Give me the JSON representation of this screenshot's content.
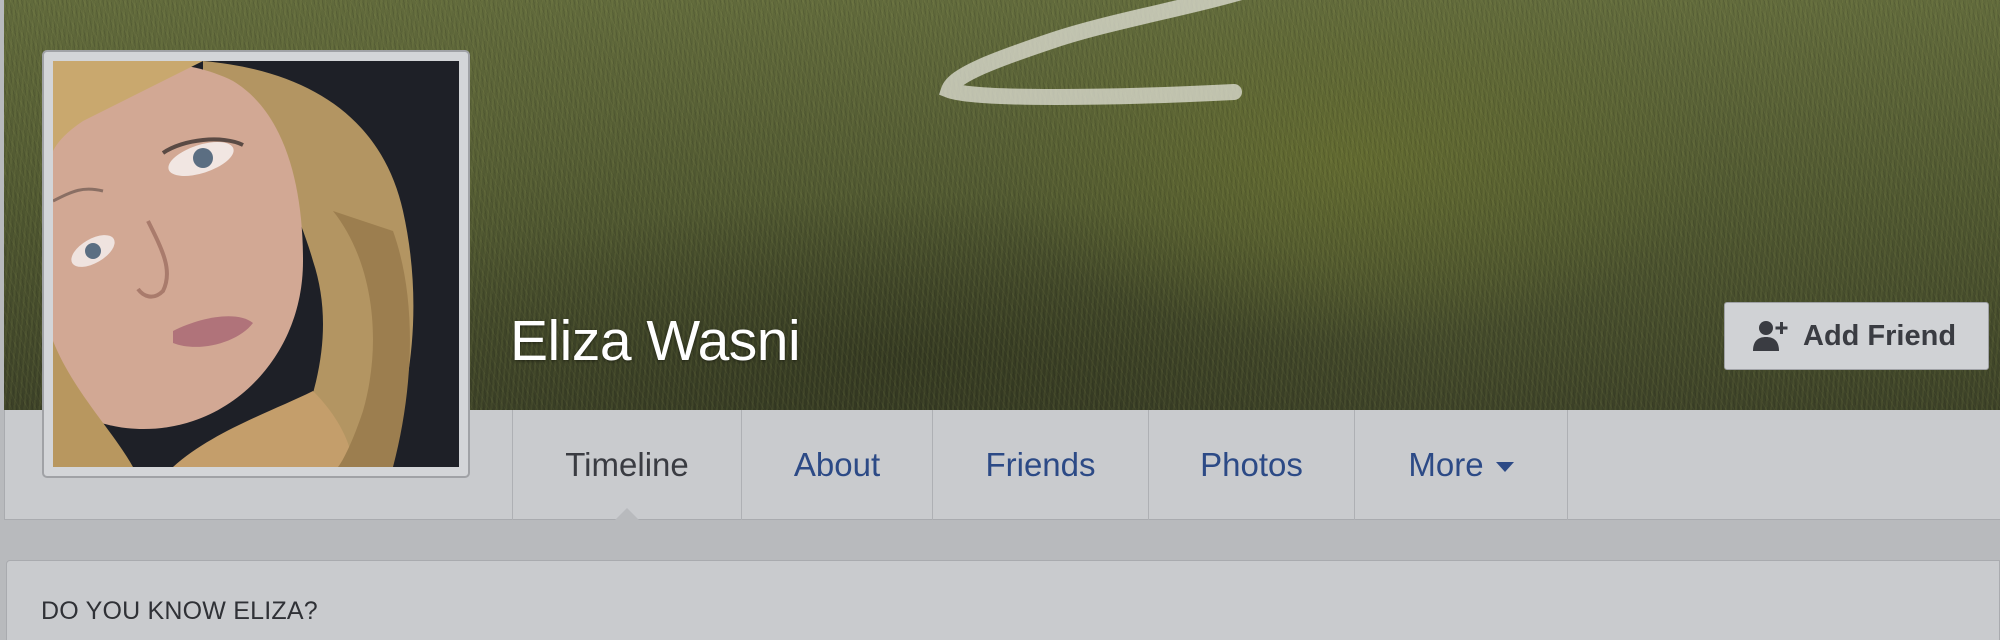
{
  "profile": {
    "name": "Eliza Wasni"
  },
  "actions": {
    "add_friend_label": "Add Friend"
  },
  "tabs": [
    {
      "label": "Timeline",
      "active": true
    },
    {
      "label": "About",
      "active": false
    },
    {
      "label": "Friends",
      "active": false
    },
    {
      "label": "Photos",
      "active": false
    },
    {
      "label": "More",
      "active": false,
      "icon": "caret-down-icon"
    }
  ],
  "cards": {
    "know_title": "DO YOU KNOW ELIZA?"
  },
  "colors": {
    "link_blue": "#2c4a86",
    "active_text": "#3a3c42",
    "panel_bg": "#c9cbce",
    "page_bg": "#b8babd"
  },
  "icons": {
    "add_friend": "add-friend-icon",
    "more_caret": "caret-down-icon"
  }
}
